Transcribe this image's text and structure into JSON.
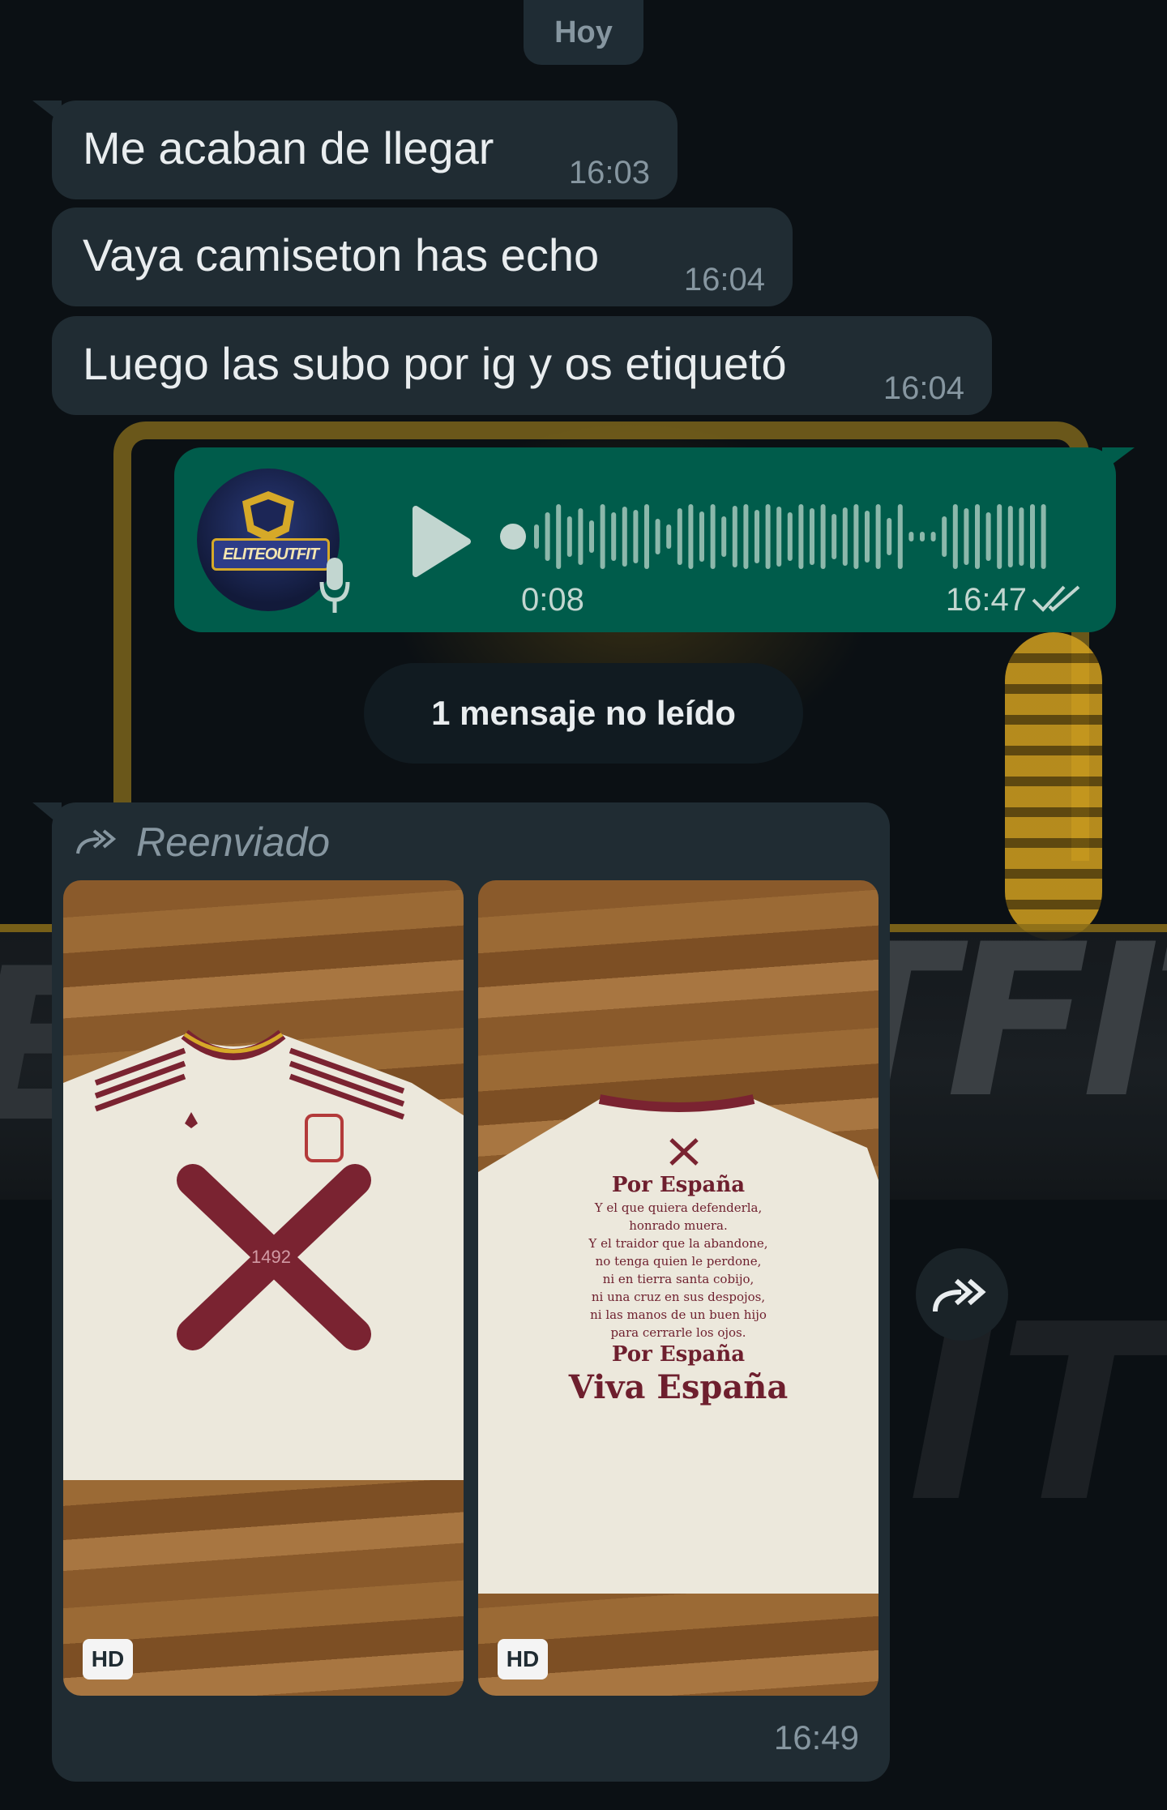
{
  "date_chip": "Hoy",
  "messages": [
    {
      "text": "Me acaban de llegar",
      "time": "16:03"
    },
    {
      "text": "Vaya camiseton has echo",
      "time": "16:04"
    },
    {
      "text": "Luego las subo por ig y os etiquetó",
      "time": "16:04"
    }
  ],
  "voice_note": {
    "avatar_text": "ELITEOUTFIT",
    "duration": "0:08",
    "time": "16:47",
    "status_icon": "double-check-icon",
    "progress": 0
  },
  "unread_divider": "1 mensaje no leído",
  "forwarded": {
    "label": "Reenviado",
    "time": "16:49",
    "photos": [
      {
        "badge": "HD",
        "shirt_number": "1492"
      },
      {
        "badge": "HD",
        "back_text": [
          "Por España",
          "Y el que quiera defenderla,",
          "honrado muera.",
          "Y el traidor que la abandone,",
          "no tenga quien le perdone,",
          "ni en tierra santa cobijo,",
          "ni una cruz en sus despojos,",
          "ni las manos de un buen hijo",
          "para cerrarle los ojos.",
          "Por España",
          "Viva España"
        ]
      }
    ]
  },
  "colors": {
    "incoming_bubble": "#202c33",
    "outgoing_bubble": "#005c4b",
    "background": "#0b1014",
    "accent_gold": "#d6a928"
  }
}
